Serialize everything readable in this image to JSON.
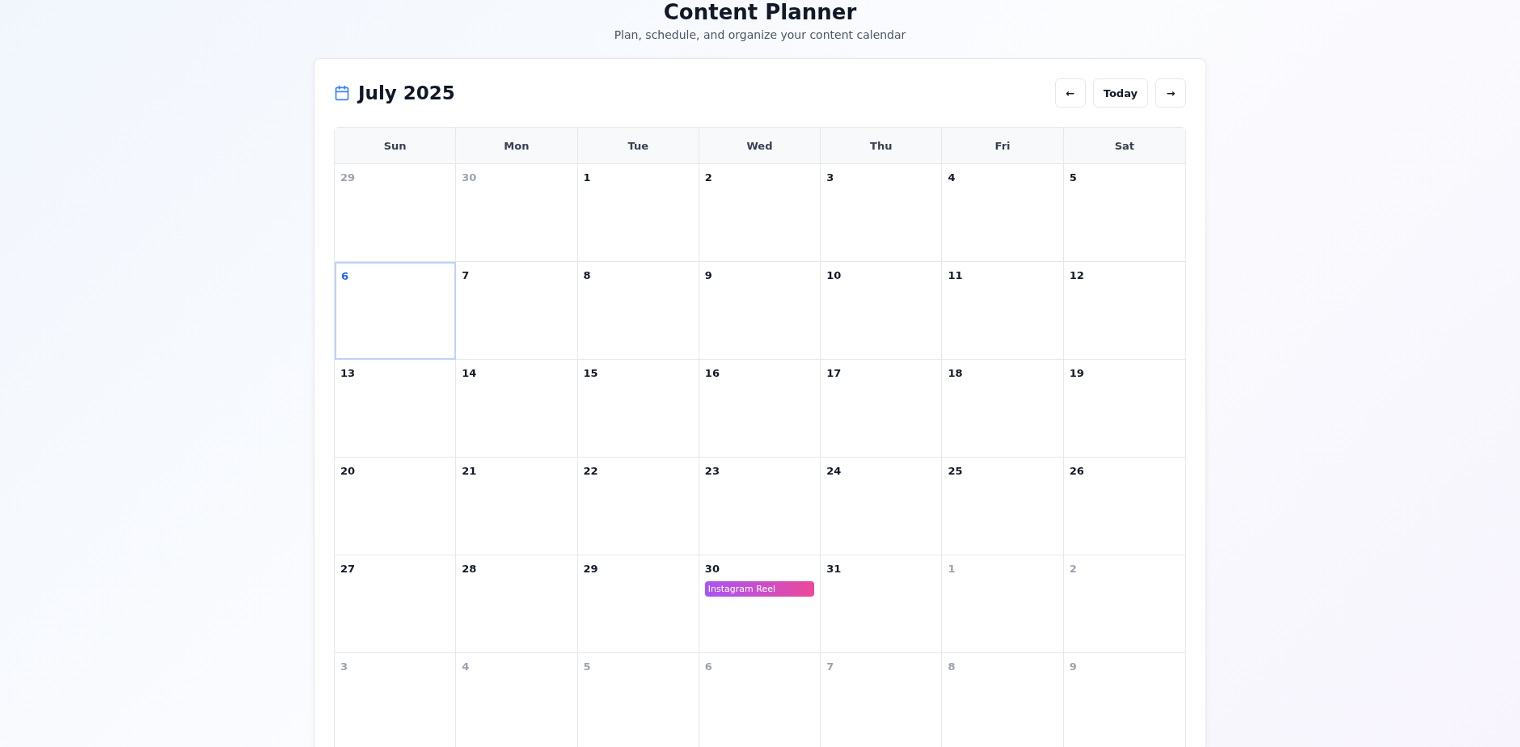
{
  "header": {
    "title": "Content Planner",
    "subtitle": "Plan, schedule, and organize your content calendar"
  },
  "calendar": {
    "month_label": "July 2025",
    "nav": {
      "prev": "←",
      "today": "Today",
      "next": "→"
    },
    "weekdays": [
      "Sun",
      "Mon",
      "Tue",
      "Wed",
      "Thu",
      "Fri",
      "Sat"
    ],
    "weeks": [
      [
        {
          "day": "29",
          "other_month": true,
          "today": false
        },
        {
          "day": "30",
          "other_month": true,
          "today": false
        },
        {
          "day": "1",
          "other_month": false,
          "today": false
        },
        {
          "day": "2",
          "other_month": false,
          "today": false
        },
        {
          "day": "3",
          "other_month": false,
          "today": false
        },
        {
          "day": "4",
          "other_month": false,
          "today": false
        },
        {
          "day": "5",
          "other_month": false,
          "today": false
        }
      ],
      [
        {
          "day": "6",
          "other_month": false,
          "today": true
        },
        {
          "day": "7",
          "other_month": false,
          "today": false
        },
        {
          "day": "8",
          "other_month": false,
          "today": false
        },
        {
          "day": "9",
          "other_month": false,
          "today": false
        },
        {
          "day": "10",
          "other_month": false,
          "today": false
        },
        {
          "day": "11",
          "other_month": false,
          "today": false
        },
        {
          "day": "12",
          "other_month": false,
          "today": false
        }
      ],
      [
        {
          "day": "13",
          "other_month": false,
          "today": false
        },
        {
          "day": "14",
          "other_month": false,
          "today": false
        },
        {
          "day": "15",
          "other_month": false,
          "today": false
        },
        {
          "day": "16",
          "other_month": false,
          "today": false
        },
        {
          "day": "17",
          "other_month": false,
          "today": false
        },
        {
          "day": "18",
          "other_month": false,
          "today": false
        },
        {
          "day": "19",
          "other_month": false,
          "today": false
        }
      ],
      [
        {
          "day": "20",
          "other_month": false,
          "today": false
        },
        {
          "day": "21",
          "other_month": false,
          "today": false
        },
        {
          "day": "22",
          "other_month": false,
          "today": false
        },
        {
          "day": "23",
          "other_month": false,
          "today": false
        },
        {
          "day": "24",
          "other_month": false,
          "today": false
        },
        {
          "day": "25",
          "other_month": false,
          "today": false
        },
        {
          "day": "26",
          "other_month": false,
          "today": false
        }
      ],
      [
        {
          "day": "27",
          "other_month": false,
          "today": false
        },
        {
          "day": "28",
          "other_month": false,
          "today": false
        },
        {
          "day": "29",
          "other_month": false,
          "today": false
        },
        {
          "day": "30",
          "other_month": false,
          "today": false,
          "events": [
            {
              "title": "Instagram Reel",
              "kind": "instagram"
            }
          ]
        },
        {
          "day": "31",
          "other_month": false,
          "today": false
        },
        {
          "day": "1",
          "other_month": true,
          "today": false
        },
        {
          "day": "2",
          "other_month": true,
          "today": false
        }
      ],
      [
        {
          "day": "3",
          "other_month": true,
          "today": false
        },
        {
          "day": "4",
          "other_month": true,
          "today": false
        },
        {
          "day": "5",
          "other_month": true,
          "today": false
        },
        {
          "day": "6",
          "other_month": true,
          "today": false
        },
        {
          "day": "7",
          "other_month": true,
          "today": false
        },
        {
          "day": "8",
          "other_month": true,
          "today": false
        },
        {
          "day": "9",
          "other_month": true,
          "today": false
        }
      ]
    ]
  }
}
